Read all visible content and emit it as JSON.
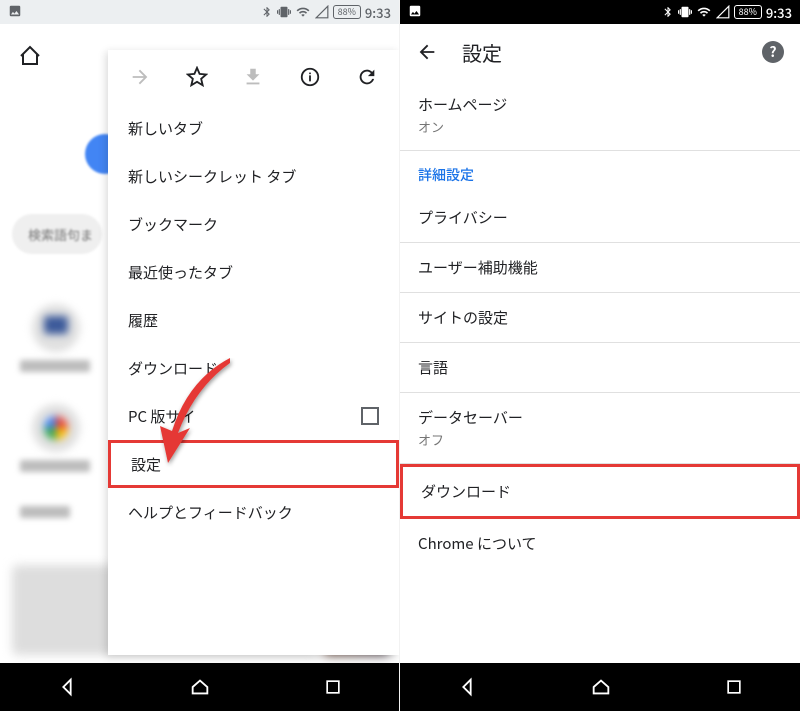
{
  "status": {
    "battery": "88%",
    "clock": "9:33"
  },
  "left": {
    "search_hint": "検索語句ま",
    "menu": {
      "items": [
        "新しいタブ",
        "新しいシークレット タブ",
        "ブックマーク",
        "最近使ったタブ",
        "履歴",
        "ダウンロード",
        "PC 版サイ",
        "設定",
        "ヘルプとフィードバック"
      ]
    }
  },
  "right": {
    "title": "設定",
    "homepage": {
      "label": "ホームページ",
      "value": "オン"
    },
    "advanced_header": "詳細設定",
    "items": {
      "privacy": "プライバシー",
      "accessibility": "ユーザー補助機能",
      "site_settings": "サイトの設定",
      "language": "言語",
      "datasaver": {
        "label": "データセーバー",
        "value": "オフ"
      },
      "downloads": "ダウンロード",
      "about": "Chrome について"
    }
  }
}
